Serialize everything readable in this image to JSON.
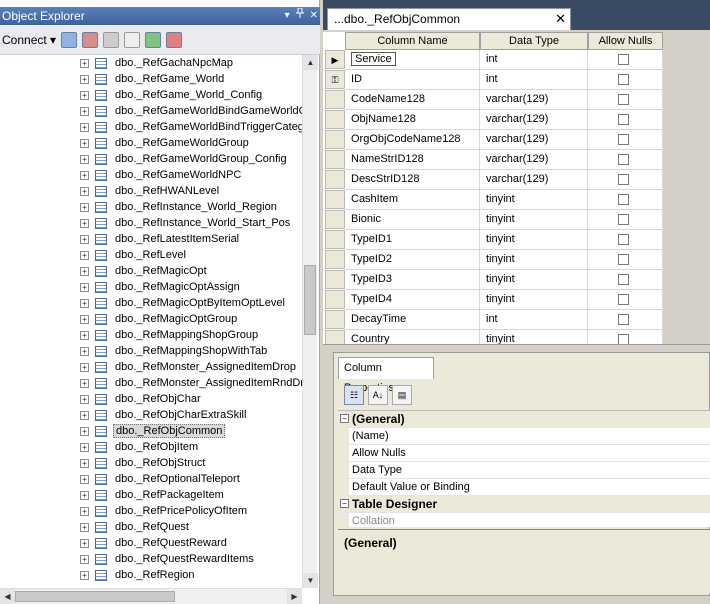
{
  "object_explorer": {
    "title": "Object Explorer",
    "controls": {
      "pin_icon": "pin-icon",
      "close_label": "✕",
      "dropdown_label": "▾"
    },
    "toolbar": {
      "connect_label": "Connect ▾"
    },
    "tree_items": [
      "dbo._RefGachaNpcMap",
      "dbo._RefGame_World",
      "dbo._RefGame_World_Config",
      "dbo._RefGameWorldBindGameWorldGr",
      "dbo._RefGameWorldBindTriggerCateg",
      "dbo._RefGameWorldGroup",
      "dbo._RefGameWorldGroup_Config",
      "dbo._RefGameWorldNPC",
      "dbo._RefHWANLevel",
      "dbo._RefInstance_World_Region",
      "dbo._RefInstance_World_Start_Pos",
      "dbo._RefLatestItemSerial",
      "dbo._RefLevel",
      "dbo._RefMagicOpt",
      "dbo._RefMagicOptAssign",
      "dbo._RefMagicOptByItemOptLevel",
      "dbo._RefMagicOptGroup",
      "dbo._RefMappingShopGroup",
      "dbo._RefMappingShopWithTab",
      "dbo._RefMonster_AssignedItemDrop",
      "dbo._RefMonster_AssignedItemRndDr",
      "dbo._RefObjChar",
      "dbo._RefObjCharExtraSkill",
      "dbo._RefObjCommon",
      "dbo._RefObjItem",
      "dbo._RefObjStruct",
      "dbo._RefOptionalTeleport",
      "dbo._RefPackageItem",
      "dbo._RefPricePolicyOfItem",
      "dbo._RefQuest",
      "dbo._RefQuestReward",
      "dbo._RefQuestRewardItems",
      "dbo._RefRegion"
    ],
    "selected_item": "dbo._RefObjCommon"
  },
  "document": {
    "tab_title": "...dbo._RefObjCommon",
    "tab_close": "✕",
    "grid": {
      "headers": [
        "Column Name",
        "Data Type",
        "Allow Nulls"
      ],
      "rows": [
        {
          "name": "Service",
          "type": "int",
          "marker": "▶"
        },
        {
          "name": "ID",
          "type": "int",
          "marker": "⚿"
        },
        {
          "name": "CodeName128",
          "type": "varchar(129)",
          "marker": ""
        },
        {
          "name": "ObjName128",
          "type": "varchar(129)",
          "marker": ""
        },
        {
          "name": "OrgObjCodeName128",
          "type": "varchar(129)",
          "marker": ""
        },
        {
          "name": "NameStrID128",
          "type": "varchar(129)",
          "marker": ""
        },
        {
          "name": "DescStrID128",
          "type": "varchar(129)",
          "marker": ""
        },
        {
          "name": "CashItem",
          "type": "tinyint",
          "marker": ""
        },
        {
          "name": "Bionic",
          "type": "tinyint",
          "marker": ""
        },
        {
          "name": "TypeID1",
          "type": "tinyint",
          "marker": ""
        },
        {
          "name": "TypeID2",
          "type": "tinyint",
          "marker": ""
        },
        {
          "name": "TypeID3",
          "type": "tinyint",
          "marker": ""
        },
        {
          "name": "TypeID4",
          "type": "tinyint",
          "marker": ""
        },
        {
          "name": "DecayTime",
          "type": "int",
          "marker": ""
        },
        {
          "name": "Country",
          "type": "tinyint",
          "marker": ""
        }
      ]
    },
    "column_properties": {
      "tab_label": "Column Properties",
      "toolbar": [
        "categorized-icon",
        "alphabetical-icon",
        "property-pages-icon"
      ],
      "rows": [
        {
          "kind": "cat",
          "label": "(General)",
          "toggle": "−"
        },
        {
          "kind": "item",
          "label": "(Name)"
        },
        {
          "kind": "item",
          "label": "Allow Nulls"
        },
        {
          "kind": "item",
          "label": "Data Type"
        },
        {
          "kind": "item",
          "label": "Default Value or Binding"
        },
        {
          "kind": "cat",
          "label": "Table Designer",
          "toggle": "−"
        },
        {
          "kind": "muted",
          "label": "Collation"
        }
      ],
      "description": "(General)"
    }
  }
}
